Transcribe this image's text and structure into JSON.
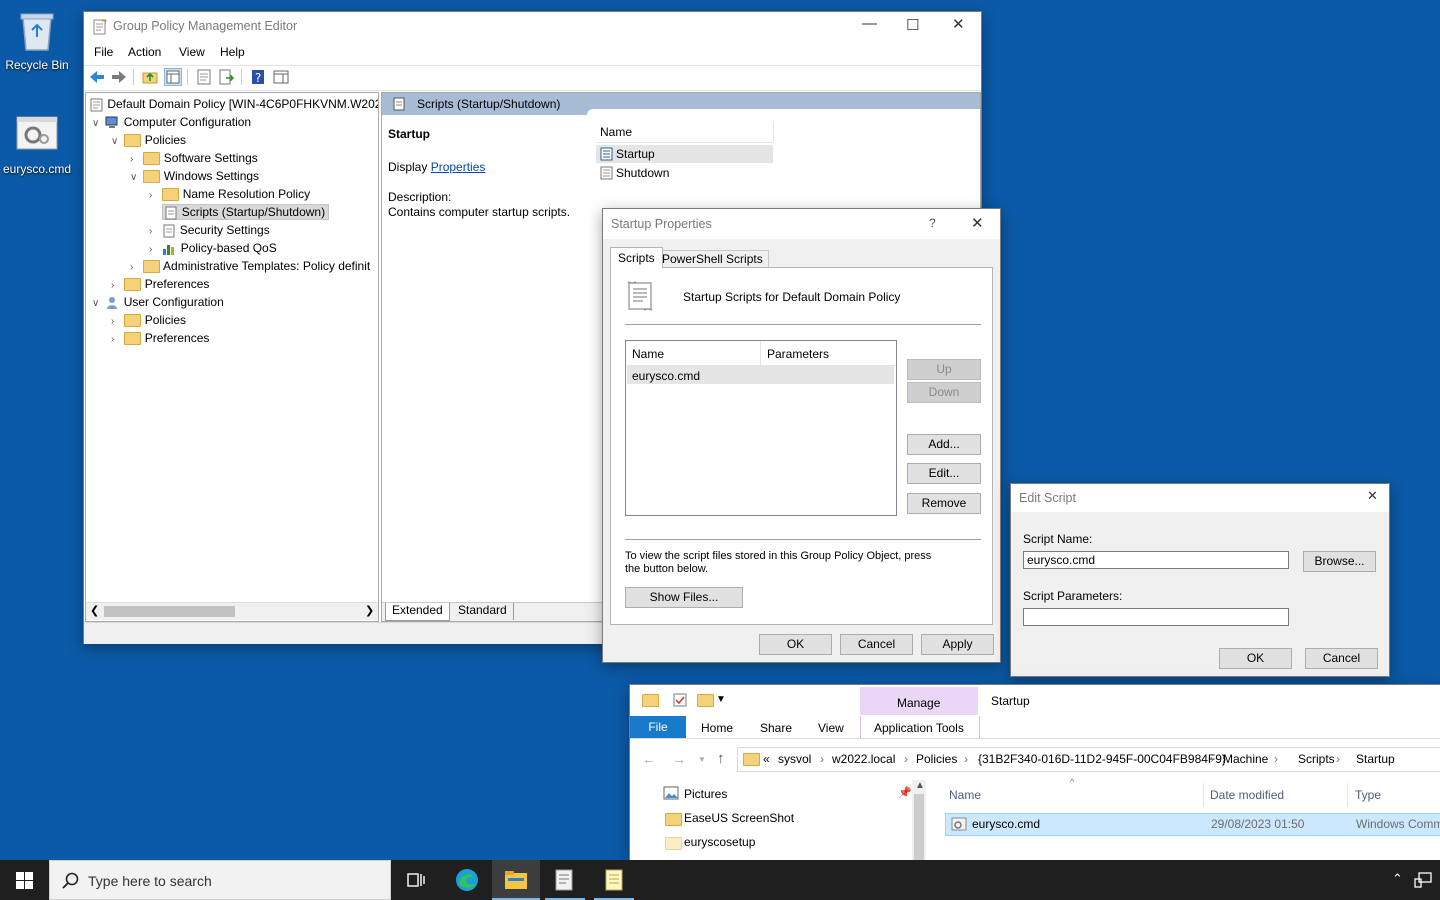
{
  "desktop": {
    "recycle_bin_label": "Recycle Bin",
    "script_icon_label": "eurysco.cmd"
  },
  "gpme": {
    "title": "Group Policy Management Editor",
    "menu": [
      "File",
      "Action",
      "View",
      "Help"
    ],
    "tree": {
      "root": "Default Domain Policy [WIN-4C6P0FHKVNM.W202",
      "computer_config": "Computer Configuration",
      "policies": "Policies",
      "software_settings": "Software Settings",
      "windows_settings": "Windows Settings",
      "name_resolution": "Name Resolution Policy",
      "scripts": "Scripts (Startup/Shutdown)",
      "security_settings": "Security Settings",
      "qos": "Policy-based QoS",
      "admin_templates": "Administrative Templates: Policy definit",
      "preferences": "Preferences",
      "user_config": "User Configuration",
      "user_policies": "Policies",
      "user_preferences": "Preferences"
    },
    "panel_header": "Scripts (Startup/Shutdown)",
    "detail_title": "Startup",
    "display_prefix": "Display ",
    "display_link": "Properties ",
    "description_label": "Description:",
    "description_text": "Contains computer startup scripts.",
    "list_header": "Name",
    "list_items": [
      "Startup",
      "Shutdown"
    ],
    "tabs": [
      "Extended",
      "Standard"
    ]
  },
  "startup_props": {
    "title": "Startup Properties",
    "help": "?",
    "tabs": [
      "Scripts",
      "PowerShell Scripts"
    ],
    "heading": "Startup Scripts for Default Domain Policy",
    "col_name": "Name",
    "col_params": "Parameters",
    "rows": [
      {
        "name": "eurysco.cmd",
        "params": ""
      }
    ],
    "btn_up": "Up",
    "btn_down": "Down",
    "btn_add": "Add...",
    "btn_edit": "Edit...",
    "btn_remove": "Remove",
    "info_text": "To view the script files stored in this Group Policy Object, press the button below.",
    "btn_show_files": "Show Files...",
    "btn_ok": "OK",
    "btn_cancel": "Cancel",
    "btn_apply": "Apply"
  },
  "edit_script": {
    "title": "Edit Script",
    "script_name_label": "Script Name:",
    "script_name_value": "eurysco.cmd",
    "btn_browse": "Browse...",
    "params_label": "Script Parameters:",
    "params_value": "",
    "btn_ok": "OK",
    "btn_cancel": "Cancel"
  },
  "explorer": {
    "title": "Startup",
    "manage_label": "Manage",
    "ribbon_tabs": [
      "File",
      "Home",
      "Share",
      "View"
    ],
    "app_tools": "Application Tools",
    "breadcrumb": [
      "«",
      "sysvol",
      "w2022.local",
      "Policies",
      "{31B2F340-016D-11D2-945F-00C04FB984F9}",
      "Machine",
      "Scripts",
      "Startup"
    ],
    "nav_items": [
      "Pictures",
      "EaseUS ScreenShot",
      "euryscosetup"
    ],
    "columns": [
      "Name",
      "Date modified",
      "Type"
    ],
    "file": {
      "name": "eurysco.cmd",
      "date": "29/08/2023 01:50",
      "type": "Windows Comm"
    }
  },
  "taskbar": {
    "search_placeholder": "Type here to search"
  }
}
